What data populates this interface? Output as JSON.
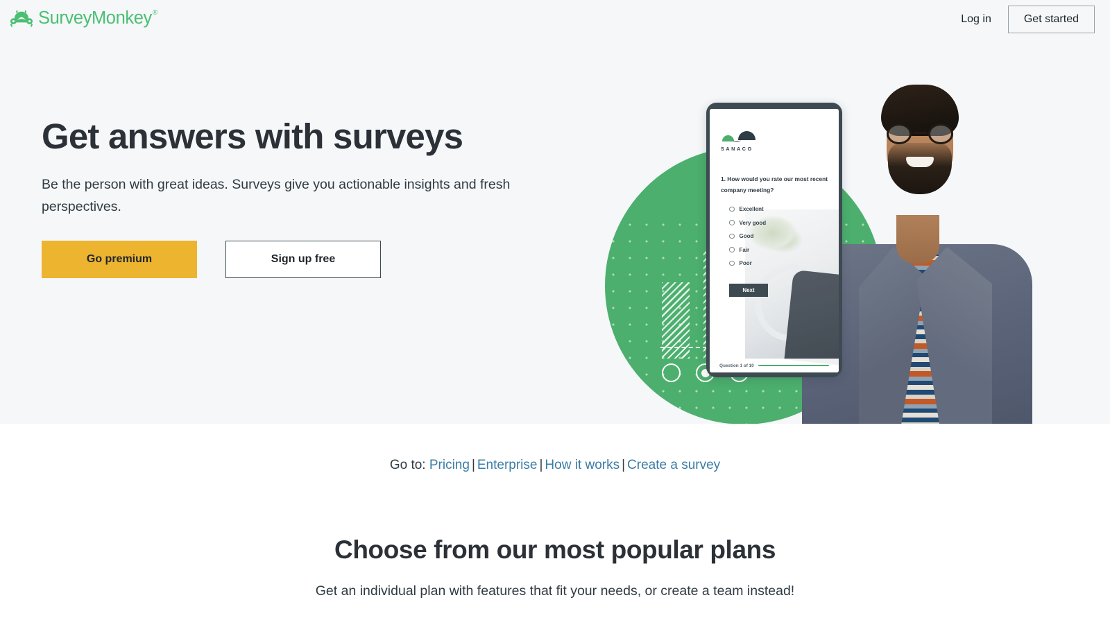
{
  "header": {
    "brand_name": "SurveyMonkey",
    "brand_registered": "®",
    "brand_color": "#4bbf73",
    "login_label": "Log in",
    "get_started_label": "Get started"
  },
  "hero": {
    "title": "Get answers with surveys",
    "subtitle": "Be the person with great ideas. Surveys give you actionable insights and fresh perspectives.",
    "primary_cta": "Go premium",
    "secondary_cta": "Sign up free",
    "background_color": "#f5f7f9",
    "primary_cta_color": "#edb430",
    "accent_green": "#4caf6d"
  },
  "phone_mockup": {
    "logo_text": "SANACO",
    "question": "1. How would you rate our most recent company meeting?",
    "options": [
      "Excellent",
      "Very good",
      "Good",
      "Fair",
      "Poor"
    ],
    "next_label": "Next",
    "progress_text": "Question 1 of 10"
  },
  "goto": {
    "label": "Go to:",
    "separator": "|",
    "links": [
      "Pricing",
      "Enterprise",
      "How it works",
      "Create a survey"
    ],
    "link_color": "#3a7ca5"
  },
  "plans": {
    "heading": "Choose from our most popular plans",
    "subheading": "Get an individual plan with features that fit your needs, or create a team instead!"
  }
}
